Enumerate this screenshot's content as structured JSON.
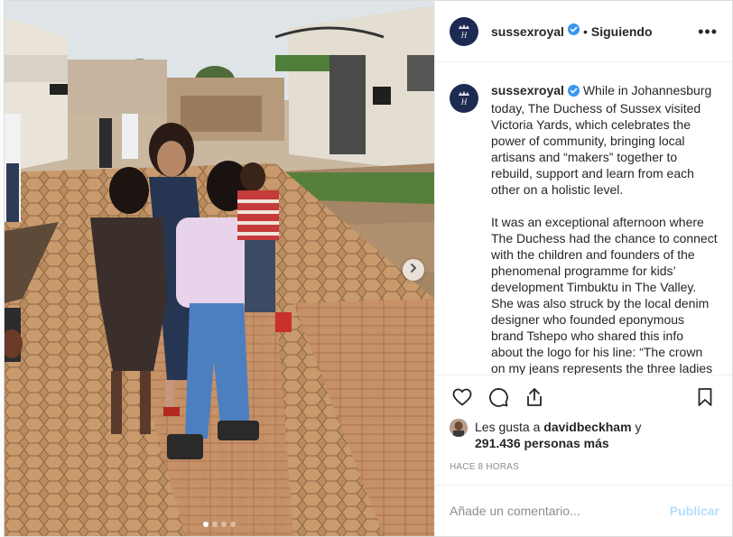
{
  "post": {
    "author": "sussexroyal",
    "following_label": "Siguiendo",
    "separator": "•",
    "more_label": "•••",
    "caption_lines": "While in Johannesburg today, The Duchess of Sussex visited Victoria Yards, which celebrates the power of community, bringing local artisans and “makers” together to rebuild, support and learn from each other on a holistic level.\n\nIt was an exceptional afternoon where The Duchess had the chance to connect with the children and founders of the phenomenal programme for kids’ development Timbuktu in The Valley. She was also struck by the local denim designer who founded eponymous brand Tshepo who shared this info about the logo for his line: “The crown on my jeans represents the three ladies who",
    "likes_prefix": "Les gusta a",
    "liker": "davidbeckham",
    "likes_conjunction": "y",
    "likes_count": "291.436 personas más",
    "timestamp": "HACE 8 HORAS",
    "comment_placeholder": "Añade un comentario...",
    "publish_label": "Publicar",
    "carousel": {
      "slides": 4,
      "active_index": 0
    }
  },
  "icons": {
    "avatar": "crown-monogram-icon",
    "verified": "verified-badge-icon",
    "like": "heart-icon",
    "comment": "comment-bubble-icon",
    "share": "share-icon",
    "save": "bookmark-icon",
    "next": "chevron-right-icon"
  },
  "colors": {
    "verified_blue": "#3897f0",
    "publish_disabled": "#b2dffc",
    "avatar_navy": "#1d2a52",
    "text": "#262626",
    "muted": "#8e8e8e"
  }
}
